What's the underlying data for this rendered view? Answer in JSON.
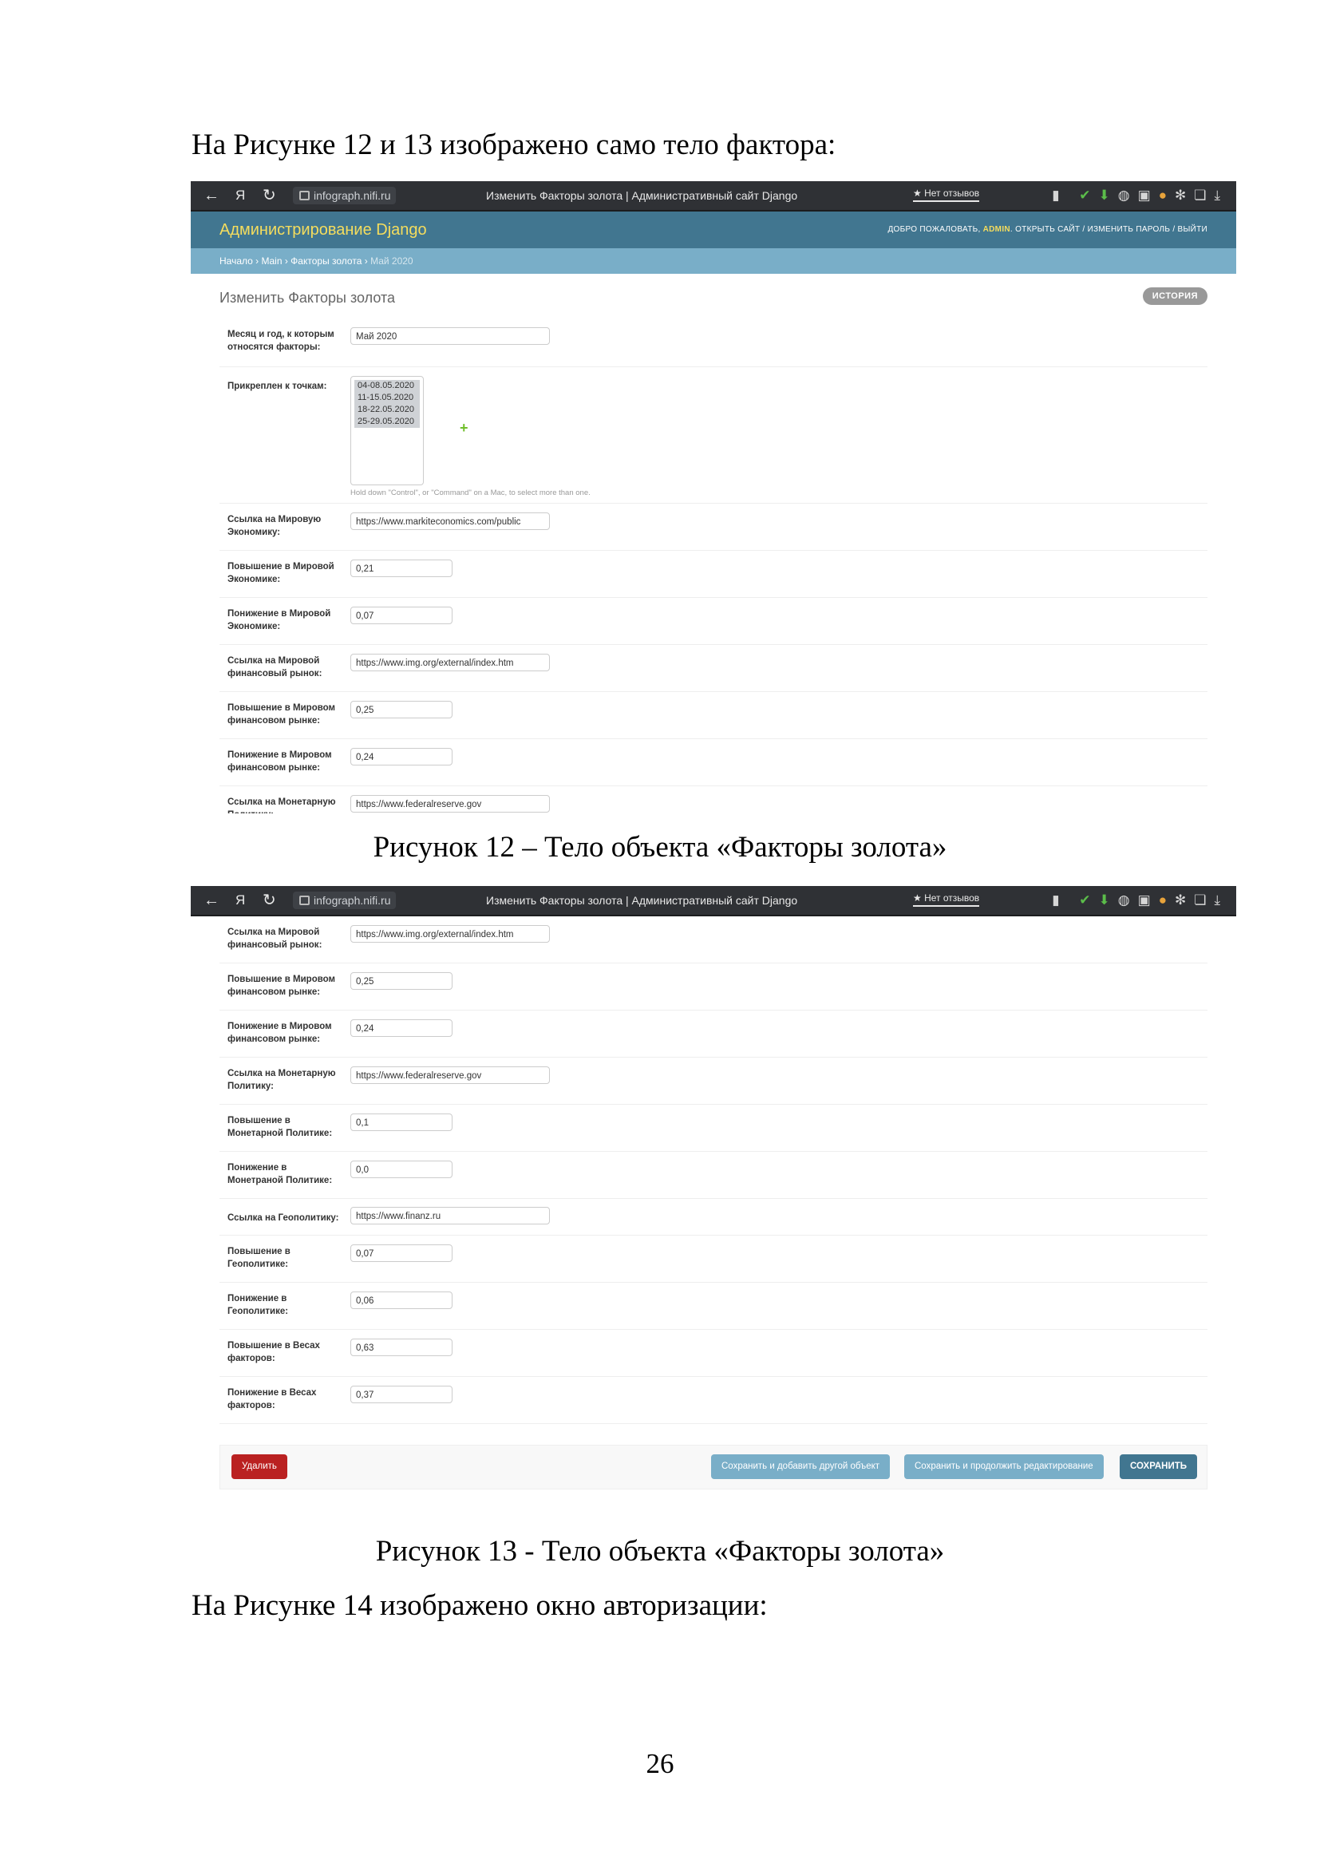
{
  "document": {
    "intro_text": "На Рисунке 12 и 13 изображено само тело фактора:",
    "caption12": "Рисунок 12 – Тело объекта «Факторы золота»",
    "caption13": "Рисунок 13 - Тело объекта «Факторы золота»",
    "outro_text": "На Рисунке 14 изображено окно авторизации:",
    "page_number": "26"
  },
  "browser": {
    "back": "←",
    "yandex": "Я",
    "reload": "↻",
    "url": "infograph.nifi.ru",
    "title": "Изменить Факторы золота | Административный сайт Django",
    "reviews": "★ Нет отзывов"
  },
  "admin": {
    "brand": "Администрирование Django",
    "welcome": "ДОБРО ПОЖАЛОВАТЬ,",
    "user": "ADMIN",
    "tools_links": ". ОТКРЫТЬ САЙТ / ИЗМЕНИТЬ ПАРОЛЬ / ВЫЙТИ",
    "breadcrumbs": {
      "home": "Начало",
      "app": "Main",
      "model": "Факторы золота",
      "current": "Май 2020",
      "sep": " › "
    },
    "page_title": "Изменить Факторы золота",
    "history_button": "ИСТОРИЯ",
    "month_label": "Месяц и год, к которым относятся факторы:",
    "month_value": "Май 2020",
    "points_label": "Прикреплен к точкам:",
    "points_options": [
      "04-08.05.2020",
      "11-15.05.2020",
      "18-22.05.2020",
      "25-29.05.2020"
    ],
    "points_help": "Hold down \"Control\", or \"Command\" on a Mac, to select more than one.",
    "fields": {
      "world_econ_link_label": "Ссылка на Мировую Экономику:",
      "world_econ_link": "https://www.markiteconomics.com/public",
      "world_econ_up_label": "Повышение в Мировой Экономике:",
      "world_econ_up": "0,21",
      "world_econ_down_label": "Понижение в Мировой Экономике:",
      "world_econ_down": "0,07",
      "fin_link_label": "Ссылка на Мировой финансовый рынок:",
      "fin_link": "https://www.img.org/external/index.htm",
      "fin_up_label": "Повышение в Мировом финансовом рынке:",
      "fin_up": "0,25",
      "fin_down_label": "Понижение в Мировом финансовом рынке:",
      "fin_down": "0,24",
      "mon_link_label": "Ссылка на Монетарную Политику:",
      "mon_link": "https://www.federalreserve.gov",
      "mon_up_label": "Повышение в Монетарной Политике:",
      "mon_up": "0,1",
      "mon_down_label": "Понижение в Монетраной Политике:",
      "mon_down": "0,0",
      "geo_link_label": "Ссылка на Геополитику:",
      "geo_link": "https://www.finanz.ru",
      "geo_up_label": "Повышение в Геополитике:",
      "geo_up": "0,07",
      "geo_down_label": "Понижение в Геополитике:",
      "geo_down": "0,06",
      "weights_up_label": "Повышение в Весах факторов:",
      "weights_up": "0,63",
      "weights_down_label": "Понижение в Весах факторов:",
      "weights_down": "0,37"
    },
    "buttons": {
      "delete": "Удалить",
      "save_add": "Сохранить и добавить другой объект",
      "save_continue": "Сохранить и продолжить редактирование",
      "save": "СОХРАНИТЬ"
    }
  },
  "colors": {
    "header": "#417690",
    "breadcrumbs": "#79aec8",
    "brand": "#f5dd5d",
    "delete": "#ba2121"
  }
}
